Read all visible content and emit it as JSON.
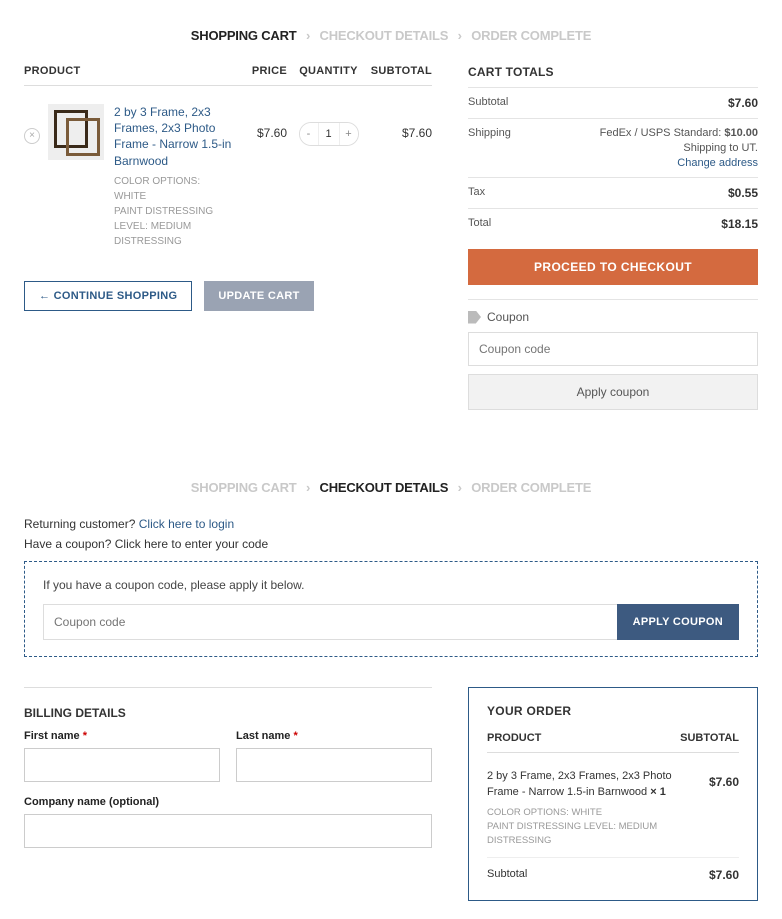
{
  "stepper": {
    "cart": "SHOPPING CART",
    "checkout": "CHECKOUT DETAILS",
    "complete": "ORDER COMPLETE",
    "sep": "›"
  },
  "cart": {
    "headers": {
      "product": "PRODUCT",
      "price": "PRICE",
      "qty": "QUANTITY",
      "subtotal": "SUBTOTAL"
    },
    "item": {
      "name": "2 by 3 Frame, 2x3 Frames, 2x3 Photo Frame - Narrow 1.5-in Barnwood",
      "meta1": "COLOR OPTIONS:  WHITE",
      "meta2": "PAINT DISTRESSING LEVEL:  MEDIUM DISTRESSING",
      "price": "$7.60",
      "qty": "1",
      "subtotal": "$7.60"
    },
    "actions": {
      "continue": "←  CONTINUE SHOPPING",
      "update": "UPDATE CART"
    }
  },
  "totals": {
    "title": "CART TOTALS",
    "subtotal_label": "Subtotal",
    "subtotal": "$7.60",
    "shipping_label": "Shipping",
    "shipping_method": "FedEx / USPS Standard:",
    "shipping_price": "$10.00",
    "shipping_to": "Shipping to UT.",
    "change_address": "Change address",
    "tax_label": "Tax",
    "tax": "$0.55",
    "total_label": "Total",
    "total": "$18.15",
    "checkout_btn": "PROCEED TO CHECKOUT",
    "coupon_label": "Coupon",
    "coupon_placeholder": "Coupon code",
    "apply": "Apply coupon"
  },
  "checkout": {
    "returning": "Returning customer? ",
    "login_link": "Click here to login",
    "have_coupon": "Have a coupon? ",
    "coupon_link": "Click here to enter your code",
    "coupon_help": "If you have a coupon code, please apply it below.",
    "coupon_placeholder": "Coupon code",
    "apply_btn": "APPLY COUPON"
  },
  "billing": {
    "title": "BILLING DETAILS",
    "first": "First name",
    "last": "Last name",
    "company": "Company name (optional)"
  },
  "order": {
    "title": "YOUR ORDER",
    "prod_head": "PRODUCT",
    "sub_head": "SUBTOTAL",
    "item_name": "2 by 3 Frame, 2x3 Frames, 2x3 Photo Frame - Narrow 1.5-in Barnwood ",
    "item_qty": "× 1",
    "meta1": "COLOR OPTIONS:  WHITE",
    "meta2": "PAINT DISTRESSING LEVEL:  MEDIUM DISTRESSING",
    "item_amt": "$7.60",
    "subtotal_label": "Subtotal",
    "subtotal": "$7.60"
  }
}
